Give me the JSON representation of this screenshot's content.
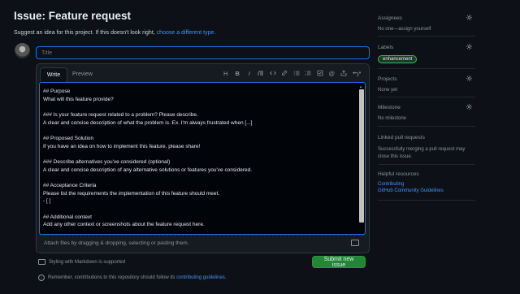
{
  "header": {
    "title": "Issue: Feature request",
    "subtitle_prefix": "Suggest an idea for this project. If this doesn't look right,",
    "subtitle_link": "choose a different type."
  },
  "title_input": {
    "placeholder": "Title",
    "value": ""
  },
  "editor": {
    "tabs": [
      "Write",
      "Preview"
    ],
    "toolbar_icons": [
      "heading-icon",
      "bold-icon",
      "italic-icon",
      "quote-icon",
      "code-icon",
      "link-icon",
      "ordered-list-icon",
      "unordered-list-icon",
      "task-list-icon",
      "mention-icon",
      "cross-reference-icon",
      "undo-icon"
    ],
    "body": "## Purpose\nWhat will this feature provide?\n\n### Is your feature request related to a problem? Please describe.\nA clear and concise description of what the problem is. Ex. I'm always frustrated when [...]\n\n## Proposed Solution\nIf you have an idea on how to implement this feature, please share!\n\n### Describe alternatives you've considered (optional)\nA clear and concise description of any alternative solutions or features you've considered.\n\n## Acceptance Criteria\nPlease list the requirements the implementation of this feature should meet.\n- [ ]\n\n## Additional context\nAdd any other context or screenshots about the feature request here.",
    "attach_text": "Attach files by dragging & dropping, selecting or pasting them."
  },
  "footer": {
    "markdown_note": "Styling with Markdown is supported",
    "submit_label": "Submit new issue",
    "reminder_prefix": "Remember, contributions to this repository should follow its",
    "reminder_link": "contributing guidelines",
    "reminder_suffix": "."
  },
  "sidebar": {
    "assignees": {
      "heading": "Assignees",
      "value": "No one—assign yourself"
    },
    "labels": {
      "heading": "Labels",
      "badge": "enhancement",
      "badge_color": "#3fb950"
    },
    "projects": {
      "heading": "Projects",
      "value": "None yet"
    },
    "milestone": {
      "heading": "Milestone",
      "value": "No milestone"
    },
    "linked_prs": {
      "heading": "Linked pull requests",
      "value": "Successfully merging a pull request may close this issue."
    },
    "helpful": {
      "heading": "Helpful resources",
      "links": [
        "Contributing",
        "GitHub Community Guidelines"
      ]
    }
  },
  "colors": {
    "background": "#0d1117",
    "accent": "#1f6feb",
    "link": "#4493f8",
    "submit": "#238636"
  }
}
